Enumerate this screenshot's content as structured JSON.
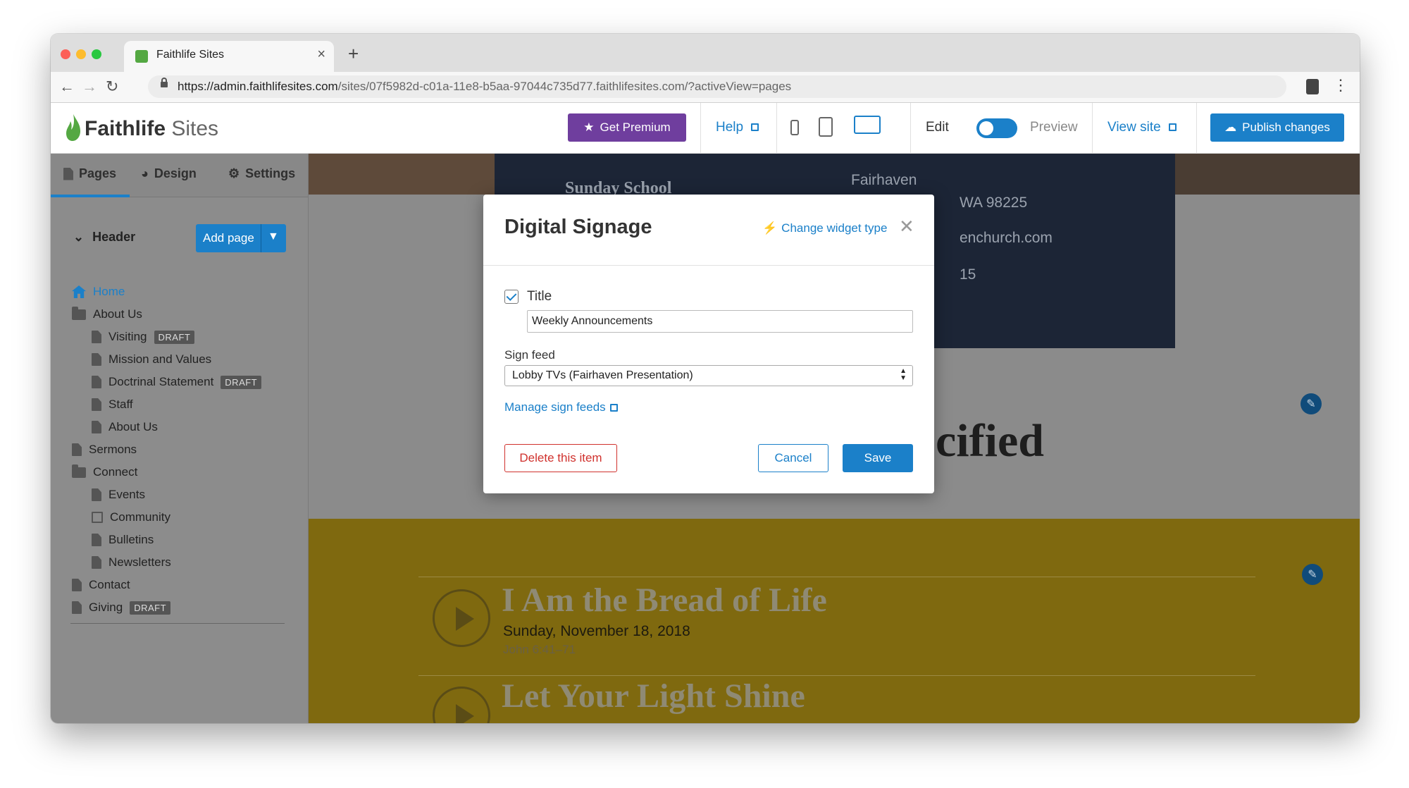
{
  "browser": {
    "tab_title": "Faithlife Sites",
    "url_host": "https://admin.faithlifesites.com",
    "url_path": "/sites/07f5982d-c01a-11e8-b5aa-97044c735d77.faithlifesites.com/?activeView=pages"
  },
  "header": {
    "logo_bold": "Faithlife",
    "logo_light": " Sites",
    "premium_label": "Get Premium",
    "help_label": "Help",
    "edit_label": "Edit",
    "preview_label": "Preview",
    "view_site_label": "View site",
    "publish_label": "Publish changes"
  },
  "sidebar": {
    "tabs": [
      "Pages",
      "Design",
      "Settings"
    ],
    "section_label": "Header",
    "add_page_label": "Add page",
    "draft_label": "DRAFT",
    "items": [
      {
        "label": "Home"
      },
      {
        "label": "About Us"
      },
      {
        "label": "Visiting"
      },
      {
        "label": "Mission and Values"
      },
      {
        "label": "Doctrinal Statement"
      },
      {
        "label": "Staff"
      },
      {
        "label": "About Us"
      },
      {
        "label": "Sermons"
      },
      {
        "label": "Connect"
      },
      {
        "label": "Events"
      },
      {
        "label": "Community"
      },
      {
        "label": "Bulletins"
      },
      {
        "label": "Newsletters"
      },
      {
        "label": "Contact"
      },
      {
        "label": "Giving"
      }
    ]
  },
  "canvas": {
    "sunday_school": "Sunday School",
    "contact_city": "Fairhaven",
    "contact_zip": "WA 98225",
    "contact_web": "enchurch.com",
    "contact_phone": "15",
    "heading_partial": "cified",
    "sermons": [
      {
        "title": "I Am the Bread of Life",
        "date": "Sunday, November 18, 2018",
        "ref": "John 6:41–71"
      },
      {
        "title": "Let Your Light Shine"
      }
    ]
  },
  "modal": {
    "title": "Digital Signage",
    "change_widget_label": "Change widget type",
    "title_checkbox_label": "Title",
    "title_value": "Weekly Announcements",
    "sign_feed_label": "Sign feed",
    "sign_feed_value": "Lobby TVs (Fairhaven Presentation)",
    "manage_link": "Manage sign feeds",
    "delete_label": "Delete this item",
    "cancel_label": "Cancel",
    "save_label": "Save"
  },
  "colors": {
    "accent": "#1b80c9",
    "premium": "#6f3e9e",
    "danger": "#d0312d"
  }
}
